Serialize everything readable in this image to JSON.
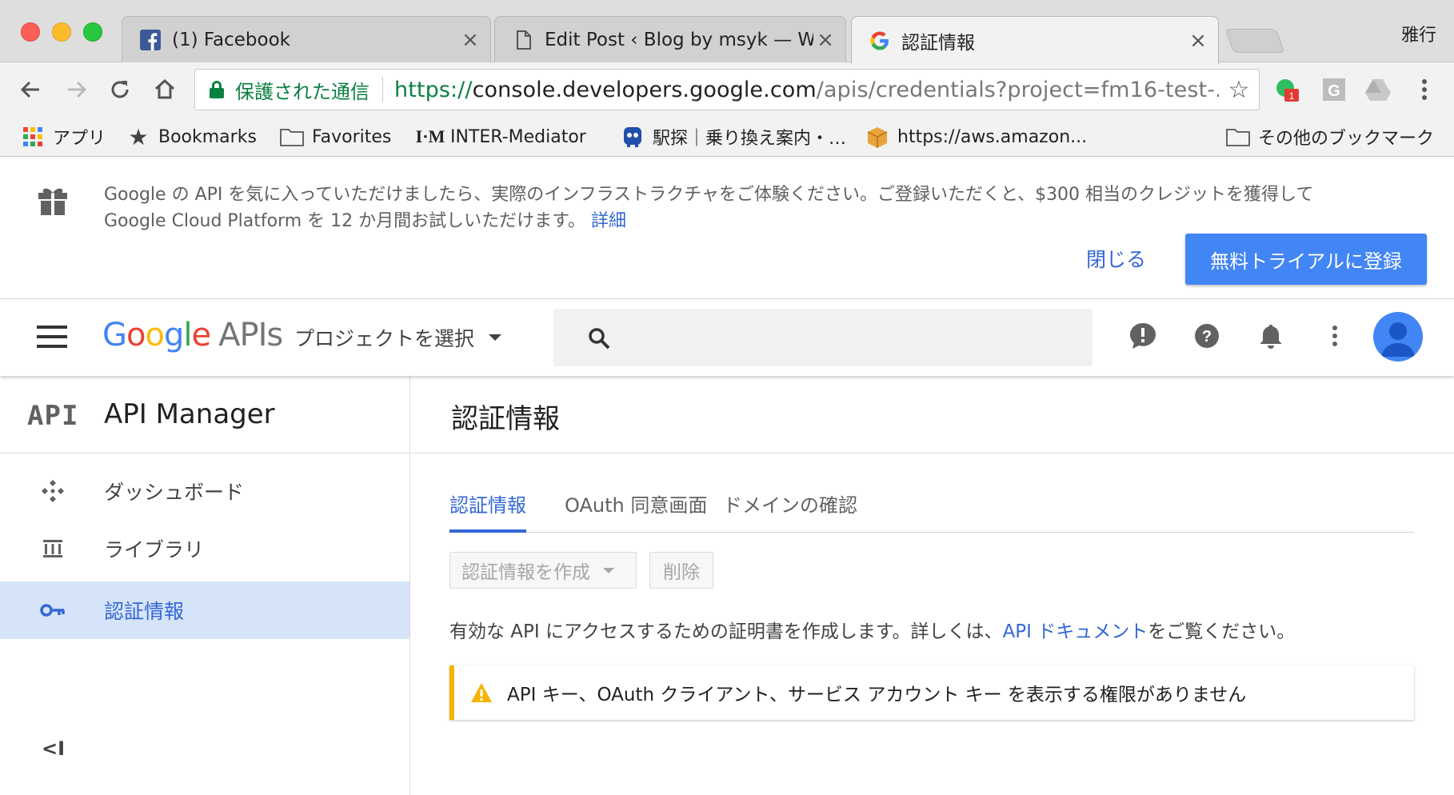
{
  "browser": {
    "profile_name": "雅行",
    "tabs": [
      {
        "title": "(1) Facebook",
        "favicon": "facebook-icon"
      },
      {
        "title": "Edit Post ‹ Blog by msyk — WordPress",
        "favicon": "page-icon"
      },
      {
        "title": "認証情報",
        "favicon": "google-icon"
      }
    ],
    "close_glyph": "×",
    "security_label": "保護された通信",
    "url": {
      "scheme": "https://",
      "host": "console.developers.google.com",
      "path": "/apis/credentials?project=fm16-test-..."
    },
    "extension_badge": "1",
    "bookmarks": [
      {
        "label": "アプリ",
        "icon": "apps-grid-icon"
      },
      {
        "label": "Bookmarks",
        "icon": "star-icon"
      },
      {
        "label": "Favorites",
        "icon": "folder-icon"
      },
      {
        "label": "INTER-Mediator",
        "icon": "im-logo-icon"
      },
      {
        "label": "駅探｜乗り換え案内・…",
        "icon": "ekitan-icon"
      },
      {
        "label": "https://aws.amazon...",
        "icon": "box-icon"
      },
      {
        "label": "その他のブックマーク",
        "icon": "folder-icon"
      }
    ]
  },
  "promo": {
    "line1": "Google の API を気に入っていただけましたら、実際のインフラストラクチャをご体験ください。ご登録いただくと、$300 相当のクレジットを獲得して",
    "line2": "Google Cloud Platform を 12 か月間お試しいただけます。",
    "details_link": "詳細",
    "close_label": "閉じる",
    "trial_button": "無料トライアルに登録"
  },
  "header": {
    "logo_google": [
      "G",
      "o",
      "o",
      "g",
      "l",
      "e"
    ],
    "logo_apis": "APIs",
    "project_selector": "プロジェクトを選択"
  },
  "sidebar": {
    "logo_text": "API",
    "title": "API Manager",
    "items": [
      {
        "label": "ダッシュボード",
        "icon": "dashboard-icon"
      },
      {
        "label": "ライブラリ",
        "icon": "library-icon"
      },
      {
        "label": "認証情報",
        "icon": "key-icon",
        "active": true
      }
    ],
    "collapse_label": "<I"
  },
  "main": {
    "page_title": "認証情報",
    "tabs": [
      {
        "label": "認証情報",
        "active": true
      },
      {
        "label": "OAuth 同意画面"
      },
      {
        "label": "ドメインの確認"
      }
    ],
    "create_button": "認証情報を作成",
    "delete_button": "削除",
    "description_prefix": "有効な API にアクセスするための証明書を作成します。詳しくは、",
    "description_link": "API ドキュメント",
    "description_suffix": "をご覧ください。",
    "warning_text": "API キー、OAuth クライアント、サービス アカウント キー を表示する権限がありません"
  },
  "colors": {
    "accent": "#4285f4",
    "link": "#3367d6",
    "secure_green": "#0b8043",
    "warning": "#f4b400",
    "active_nav_bg": "#d6e4f9"
  }
}
